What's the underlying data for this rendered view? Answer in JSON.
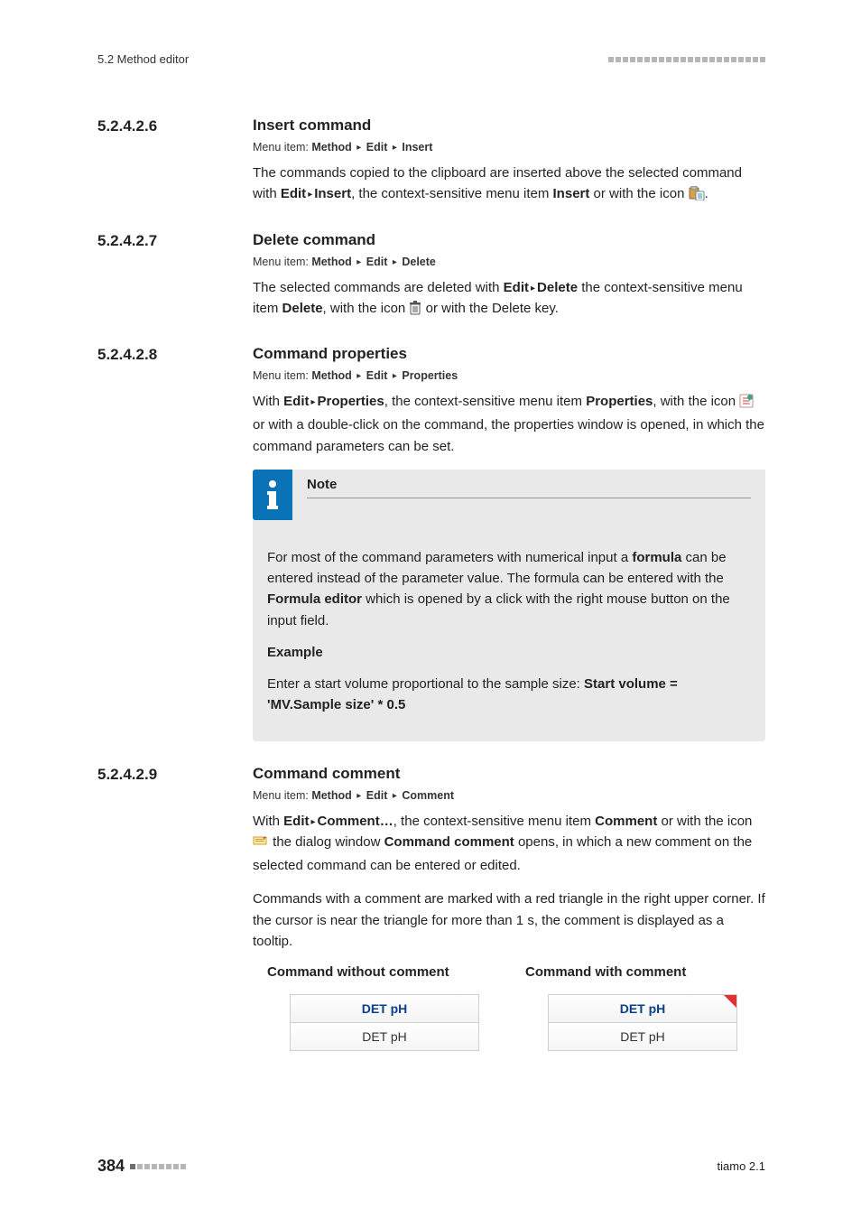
{
  "runhead": {
    "left": "5.2 Method editor"
  },
  "sections": {
    "s1": {
      "num": "5.2.4.2.6",
      "title": "Insert command",
      "menu": {
        "label": "Menu item: ",
        "p1": "Method",
        "p2": "Edit",
        "p3": "Insert"
      },
      "para_a": "The commands copied to the clipboard are inserted above the selected command with ",
      "para_b": "Edit",
      "para_c": "Insert",
      "para_d": ", the context-sensitive menu item ",
      "para_e": "Insert",
      "para_f": " or with the icon ",
      "para_g": "."
    },
    "s2": {
      "num": "5.2.4.2.7",
      "title": "Delete command",
      "menu": {
        "label": "Menu item: ",
        "p1": "Method",
        "p2": "Edit",
        "p3": "Delete"
      },
      "para_a": "The selected commands are deleted with ",
      "para_b": "Edit",
      "para_c": "Delete",
      "para_d": " the context-sensitive menu item ",
      "para_e": "Delete",
      "para_f": ", with the icon ",
      "para_g": " or with the Delete key."
    },
    "s3": {
      "num": "5.2.4.2.8",
      "title": "Command properties",
      "menu": {
        "label": "Menu item: ",
        "p1": "Method",
        "p2": "Edit",
        "p3": "Properties"
      },
      "para_a": "With ",
      "para_b": "Edit",
      "para_c": "Properties",
      "para_d": ", the context-sensitive menu item ",
      "para_e": "Properties",
      "para_f": ", with the icon ",
      "para_g": " or with a double-click on the command, the properties window is opened, in which the command parameters can be set.",
      "note": {
        "title": "Note",
        "p1a": "For most of the command parameters with numerical input a ",
        "p1b": "formula",
        "p1c": " can be entered instead of the parameter value. The formula can be entered with the ",
        "p1d": "Formula editor",
        "p1e": " which is opened by a click with the right mouse button on the input field.",
        "ex_label": "Example",
        "p2a": "Enter a start volume proportional to the sample size: ",
        "p2b": "Start volume = 'MV.Sample size' * 0.5"
      }
    },
    "s4": {
      "num": "5.2.4.2.9",
      "title": "Command comment",
      "menu": {
        "label": "Menu item: ",
        "p1": "Method",
        "p2": "Edit",
        "p3": "Comment"
      },
      "para_a": "With ",
      "para_b": "Edit",
      "para_c": "Comment…",
      "para_d": ", the context-sensitive menu item ",
      "para_e": "Comment",
      "para_f": " or with the icon ",
      "para_g": " the dialog window ",
      "para_h": "Command comment",
      "para_i": " opens, in which a new comment on the selected command can be entered or edited.",
      "para2": "Commands with a comment are marked with a red triangle in the right upper corner. If the cursor is near the triangle for more than 1 s, the comment is displayed as a tooltip.",
      "table": {
        "h1": "Command without comment",
        "h2": "Command with comment",
        "cell": "DET pH"
      }
    }
  },
  "footer": {
    "page": "384",
    "product": "tiamo 2.1"
  }
}
